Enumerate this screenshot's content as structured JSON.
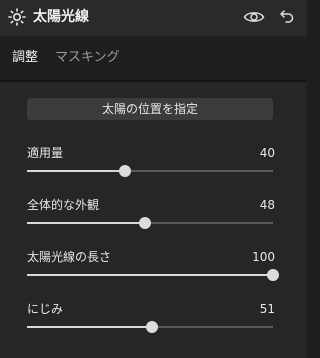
{
  "header": {
    "icon": "sun-icon",
    "title": "太陽光線",
    "visibility_icon": "eye-icon",
    "reset_icon": "undo-icon"
  },
  "tabs": [
    {
      "label": "調整",
      "active": true
    },
    {
      "label": "マスキング",
      "active": false
    }
  ],
  "sun_position_button": {
    "label": "太陽の位置を指定"
  },
  "sliders": [
    {
      "label": "適用量",
      "value": "40",
      "fraction": 0.4
    },
    {
      "label": "全体的な外観",
      "value": "48",
      "fraction": 0.48
    },
    {
      "label": "太陽光線の長さ",
      "value": "100",
      "fraction": 1.0
    },
    {
      "label": "にじみ",
      "value": "51",
      "fraction": 0.51
    }
  ],
  "colors": {
    "background": "#1e1e1e",
    "header": "#2a2a2a",
    "content": "#262626",
    "button": "#3c3c3c",
    "track": "#5a5a5a",
    "fill": "#d8d8d8"
  }
}
